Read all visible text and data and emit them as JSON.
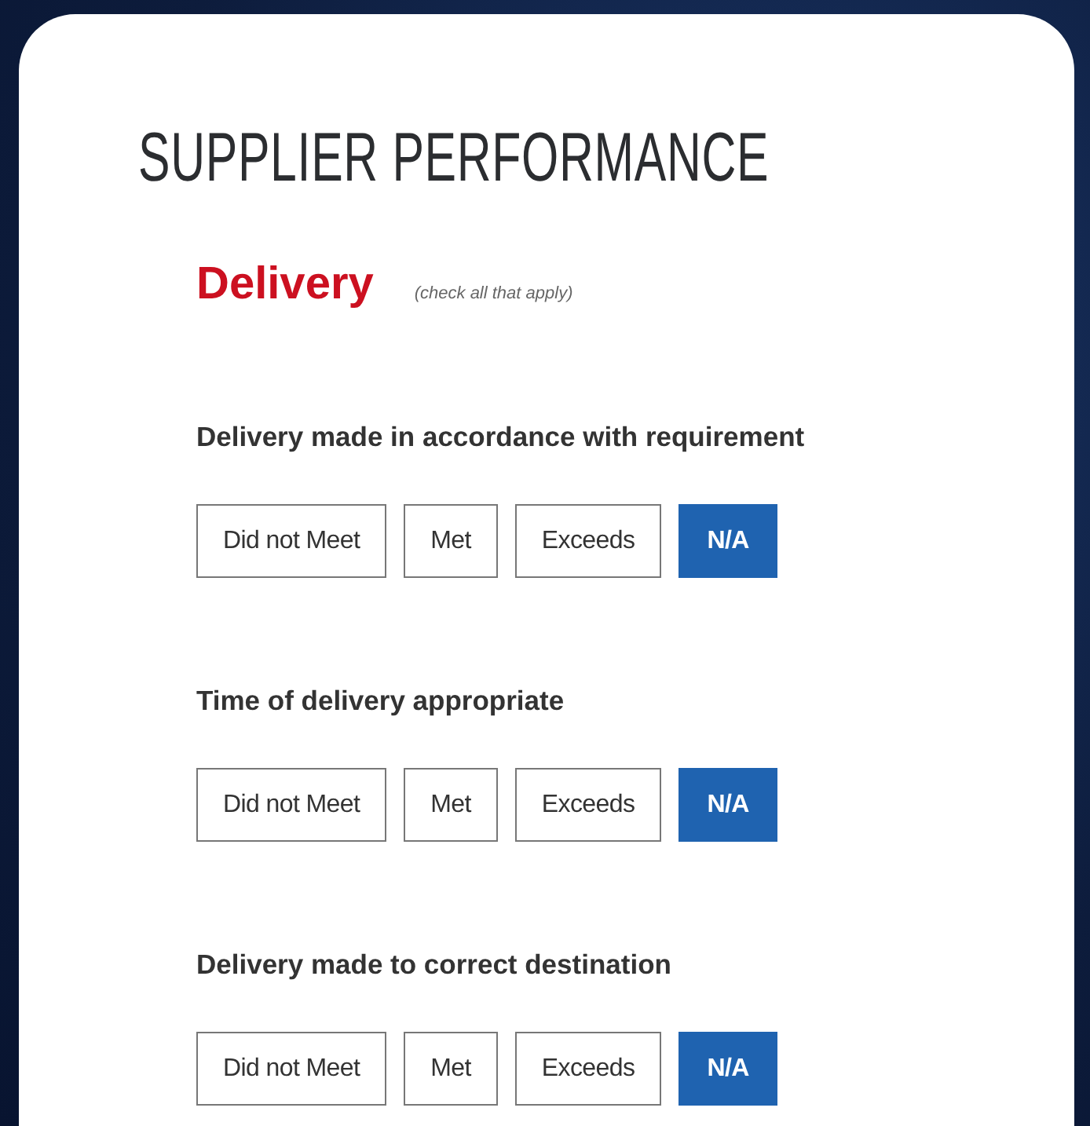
{
  "title": "SUPPLIER PERFORMANCE",
  "section": {
    "heading": "Delivery",
    "note": "(check all that apply)"
  },
  "questions": [
    {
      "label": "Delivery made in accordance with requirement",
      "options": [
        {
          "label": "Did not Meet",
          "selected": false
        },
        {
          "label": "Met",
          "selected": false
        },
        {
          "label": "Exceeds",
          "selected": false
        },
        {
          "label": "N/A",
          "selected": true
        }
      ]
    },
    {
      "label": "Time of delivery appropriate",
      "options": [
        {
          "label": "Did not Meet",
          "selected": false
        },
        {
          "label": "Met",
          "selected": false
        },
        {
          "label": "Exceeds",
          "selected": false
        },
        {
          "label": "N/A",
          "selected": true
        }
      ]
    },
    {
      "label": "Delivery made to correct destination",
      "options": [
        {
          "label": "Did not Meet",
          "selected": false
        },
        {
          "label": "Met",
          "selected": false
        },
        {
          "label": "Exceeds",
          "selected": false
        },
        {
          "label": "N/A",
          "selected": true
        }
      ]
    }
  ]
}
